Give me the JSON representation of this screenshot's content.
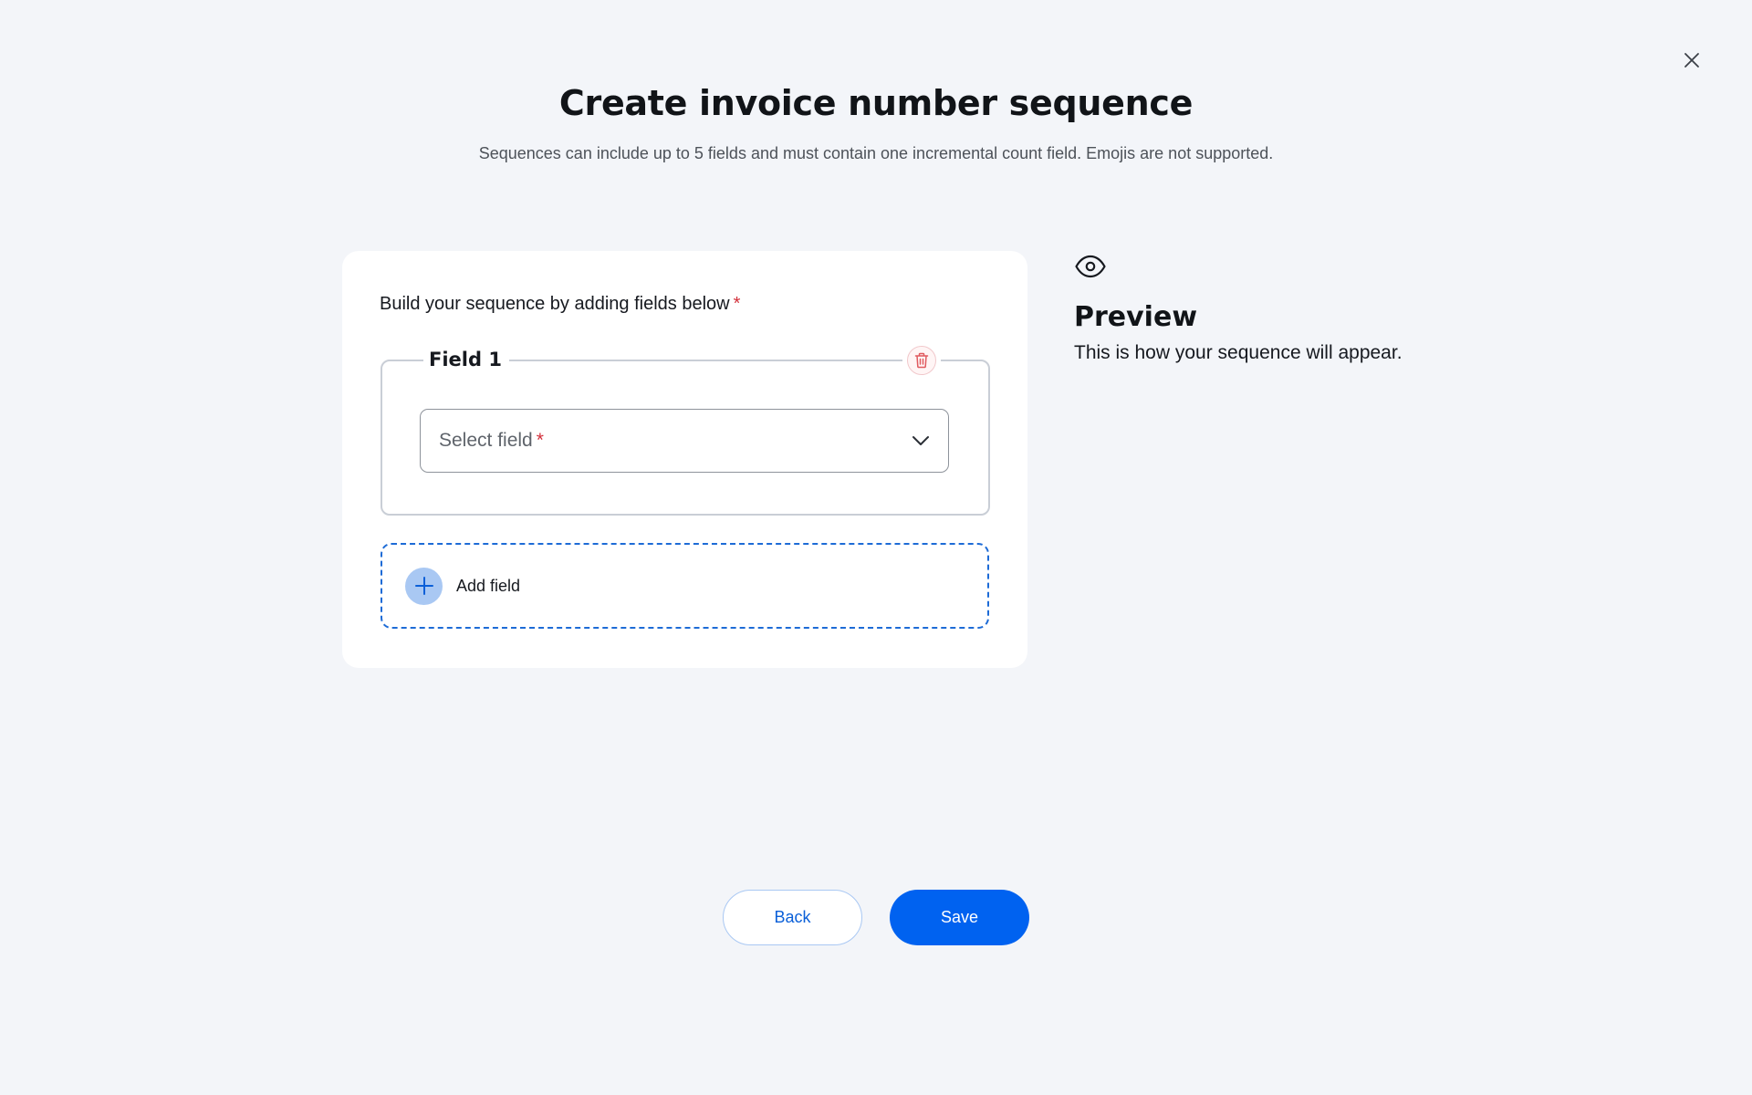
{
  "dialog": {
    "title": "Create invoice number sequence",
    "subtitle": "Sequences can include up to 5 fields and must contain one incremental count field. Emojis are not supported.",
    "close_icon": "close-icon"
  },
  "builder": {
    "heading": "Build your sequence by adding fields below",
    "required_mark": "*",
    "fields": [
      {
        "legend": "Field 1",
        "delete_icon": "trash-icon",
        "select_placeholder": "Select field",
        "select_required_mark": "*",
        "dropdown_icon": "chevron-down-icon"
      }
    ],
    "add_field_label": "Add field",
    "add_icon": "plus-icon"
  },
  "preview": {
    "icon": "eye-icon",
    "title": "Preview",
    "description": "This is how your sequence will appear."
  },
  "footer": {
    "back_label": "Back",
    "save_label": "Save"
  },
  "colors": {
    "background": "#f3f5f9",
    "primary": "#0062f0",
    "required": "#d32f3a",
    "dashed_border": "#1d6bd6",
    "delete": "#e05a5f"
  }
}
